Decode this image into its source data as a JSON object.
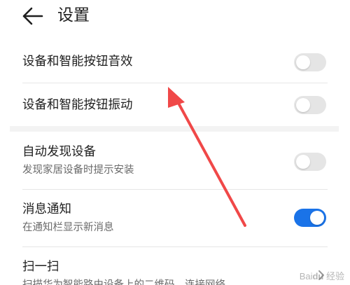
{
  "header": {
    "title": "设置",
    "back_icon": "arrow-left-icon"
  },
  "settings": {
    "sound": {
      "title": "设备和智能按钮音效",
      "enabled": false
    },
    "vibration": {
      "title": "设备和智能按钮振动",
      "enabled": false
    },
    "auto_discover": {
      "title": "自动发现设备",
      "subtitle": "发现家居设备时提示安装",
      "enabled": false
    },
    "notifications": {
      "title": "消息通知",
      "subtitle": "在通知栏显示新消息",
      "enabled": true
    },
    "scan": {
      "title": "扫一扫",
      "subtitle": "扫描华为智能路由设备上的二维码，连接网络",
      "icon": "chevron-right-icon"
    }
  },
  "colors": {
    "toggle_on": "#1a73e8",
    "toggle_off": "#e5e5e5",
    "annotation_arrow": "#f04848"
  },
  "watermark": {
    "text": "Bai 经验"
  }
}
